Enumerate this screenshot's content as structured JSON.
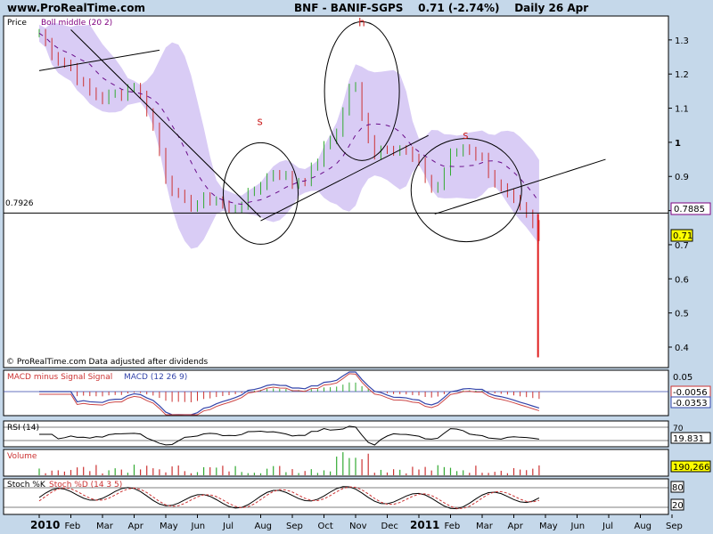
{
  "header": {
    "site": "www.ProRealTime.com",
    "symbol": "BNF - BANIF-SGPS",
    "last": "0.71 (-2.74%)",
    "period": "Daily",
    "date": "26 Apr"
  },
  "price_panel": {
    "label_price": "Price",
    "label_boll": "Boll middle (20 2)",
    "footer": "© ProRealTime.com Data adjusted after dividends",
    "level_label": "0.7926",
    "badge_boll": "0.7885",
    "badge_last": "0.71",
    "pattern_labels": [
      "s",
      "h",
      "s"
    ]
  },
  "macd_panel": {
    "label_a": "MACD minus Signal Signal",
    "label_b": "MACD (12 26 9)",
    "ticks": [
      "0.05",
      "0"
    ],
    "badge_a": "-0.0056",
    "badge_b": "-0.0353"
  },
  "rsi_panel": {
    "label": "RSI (14)",
    "ticks": [
      "70",
      "30"
    ],
    "badge": "19.831"
  },
  "volume_panel": {
    "label": "Volume",
    "badge": "190,266"
  },
  "stoch_panel": {
    "label_a": "Stoch %K",
    "label_b": "Stoch %D (14 3 5)",
    "ticks": [
      "80",
      "20"
    ],
    "badge_a": "80",
    "badge_b": "20"
  },
  "x_axis": [
    "2010",
    "Feb",
    "Mar",
    "Apr",
    "May",
    "Jun",
    "Jul",
    "Aug",
    "Sep",
    "Oct",
    "Nov",
    "Dec",
    "2011",
    "Feb",
    "Mar",
    "Apr",
    "May",
    "Jun",
    "Jul",
    "Aug",
    "Sep"
  ],
  "colors": {
    "background": "#c5d8ea",
    "panel": "#ffffff",
    "band": "#d9ccf5",
    "bull": "#33aa33",
    "bear": "#cc3333",
    "boll_mid": "#6a0d8a",
    "macd": "#3344aa",
    "signal": "#cc4444",
    "badge_yellow": "#ffff00"
  },
  "chart_data": {
    "type": "candlestick",
    "title": "BNF - BANIF-SGPS",
    "y_ticks": [
      0.4,
      0.5,
      0.6,
      0.7,
      0.8,
      0.9,
      1,
      1.1,
      1.2,
      1.3
    ],
    "ylim": [
      0.34,
      1.37
    ],
    "x_months": [
      "2010",
      "Feb",
      "Mar",
      "Apr",
      "May",
      "Jun",
      "Jul",
      "Aug",
      "Sep",
      "Oct",
      "Nov",
      "Dec",
      "2011",
      "Feb",
      "Mar",
      "Apr",
      "May",
      "Jun",
      "Jul",
      "Aug",
      "Sep"
    ],
    "price_path": [
      [
        0,
        1.32
      ],
      [
        0.5,
        1.25
      ],
      [
        1,
        1.22
      ],
      [
        1.5,
        1.15
      ],
      [
        2,
        1.13
      ],
      [
        2.5,
        1.14
      ],
      [
        3,
        1.17
      ],
      [
        3.5,
        1.08
      ],
      [
        4,
        0.9
      ],
      [
        4.5,
        0.82
      ],
      [
        5,
        0.82
      ],
      [
        5.5,
        0.84
      ],
      [
        6,
        0.8
      ],
      [
        6.5,
        0.83
      ],
      [
        7,
        0.88
      ],
      [
        7.5,
        0.92
      ],
      [
        8,
        0.88
      ],
      [
        8.5,
        0.9
      ],
      [
        9,
        0.98
      ],
      [
        9.5,
        1.05
      ],
      [
        9.9,
        1.2
      ],
      [
        10.2,
        1.07
      ],
      [
        10.6,
        0.97
      ],
      [
        11,
        0.99
      ],
      [
        11.5,
        0.98
      ],
      [
        12,
        0.93
      ],
      [
        12.5,
        0.85
      ],
      [
        13,
        0.96
      ],
      [
        13.5,
        0.99
      ],
      [
        14,
        0.95
      ],
      [
        14.5,
        0.87
      ],
      [
        15,
        0.82
      ],
      [
        15.5,
        0.77
      ],
      [
        15.85,
        0.71
      ]
    ],
    "support_level": 0.7926,
    "last_value": 0.71,
    "boll_middle_last": 0.7885,
    "low_wick_last": 0.37,
    "trendlines": [
      [
        [
          0,
          1.21
        ],
        [
          3.8,
          1.27
        ]
      ],
      [
        [
          1.0,
          1.33
        ],
        [
          7.0,
          0.78
        ]
      ],
      [
        [
          7.0,
          0.77
        ],
        [
          12.3,
          1.02
        ]
      ],
      [
        [
          12.5,
          0.79
        ],
        [
          17.9,
          0.95
        ]
      ]
    ],
    "pattern_annotations": [
      {
        "label": "s",
        "x": 7.0,
        "y": 1.05
      },
      {
        "label": "h",
        "x": 10.2,
        "y": 1.34
      },
      {
        "label": "s",
        "x": 13.5,
        "y": 1.01
      }
    ],
    "indicators": {
      "macd": {
        "last": -0.0056,
        "signal_last": -0.0353
      },
      "rsi": {
        "last": 19.831,
        "levels": [
          70,
          30
        ]
      },
      "volume": {
        "last": 190266
      },
      "stochastic": {
        "levels": [
          80,
          20
        ]
      }
    }
  }
}
